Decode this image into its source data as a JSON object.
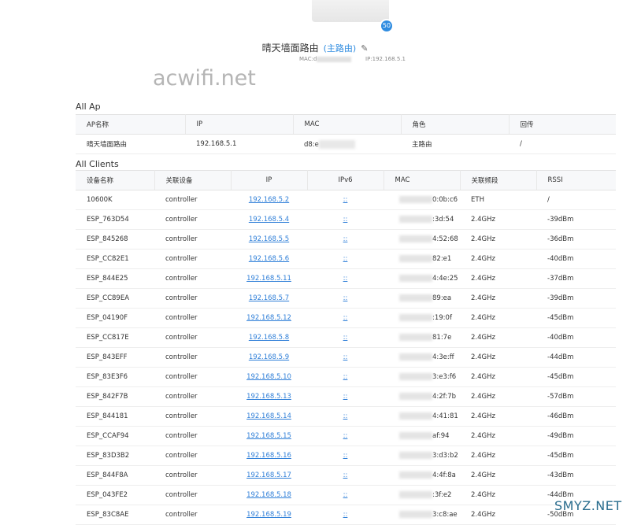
{
  "device": {
    "badge": "50"
  },
  "router": {
    "name": "晴天墙面路由",
    "role": "(主路由)",
    "mac_label": "MAC:d",
    "ip_label": "IP:192.168.5.1"
  },
  "watermark": "acwifi.net",
  "ap_section": {
    "title": "All Ap",
    "headers": [
      "AP名称",
      "IP",
      "MAC",
      "角色",
      "回传"
    ],
    "rows": [
      {
        "name": "晴天墙面路由",
        "ip": "192.168.5.1",
        "mac": "d8:e",
        "role": "主路由",
        "backhaul": "/"
      }
    ]
  },
  "clients_section": {
    "title": "All Clients",
    "headers": [
      "设备名称",
      "关联设备",
      "IP",
      "IPv6",
      "MAC",
      "关联频段",
      "RSSI"
    ],
    "rows": [
      {
        "name": "10600K",
        "device": "controller",
        "ip": "192.168.5.2",
        "ipv6": "::",
        "mac": "0:0b:c6",
        "band": "ETH",
        "rssi": "/"
      },
      {
        "name": "ESP_763D54",
        "device": "controller",
        "ip": "192.168.5.4",
        "ipv6": "::",
        "mac": ":3d:54",
        "band": "2.4GHz",
        "rssi": "-39dBm"
      },
      {
        "name": "ESP_845268",
        "device": "controller",
        "ip": "192.168.5.5",
        "ipv6": "::",
        "mac": "4:52:68",
        "band": "2.4GHz",
        "rssi": "-36dBm"
      },
      {
        "name": "ESP_CC82E1",
        "device": "controller",
        "ip": "192.168.5.6",
        "ipv6": "::",
        "mac": "82:e1",
        "band": "2.4GHz",
        "rssi": "-40dBm"
      },
      {
        "name": "ESP_844E25",
        "device": "controller",
        "ip": "192.168.5.11",
        "ipv6": "::",
        "mac": "4:4e:25",
        "band": "2.4GHz",
        "rssi": "-37dBm"
      },
      {
        "name": "ESP_CC89EA",
        "device": "controller",
        "ip": "192.168.5.7",
        "ipv6": "::",
        "mac": "89:ea",
        "band": "2.4GHz",
        "rssi": "-39dBm"
      },
      {
        "name": "ESP_04190F",
        "device": "controller",
        "ip": "192.168.5.12",
        "ipv6": "::",
        "mac": ":19:0f",
        "band": "2.4GHz",
        "rssi": "-45dBm"
      },
      {
        "name": "ESP_CC817E",
        "device": "controller",
        "ip": "192.168.5.8",
        "ipv6": "::",
        "mac": "81:7e",
        "band": "2.4GHz",
        "rssi": "-40dBm"
      },
      {
        "name": "ESP_843EFF",
        "device": "controller",
        "ip": "192.168.5.9",
        "ipv6": "::",
        "mac": "4:3e:ff",
        "band": "2.4GHz",
        "rssi": "-44dBm"
      },
      {
        "name": "ESP_83E3F6",
        "device": "controller",
        "ip": "192.168.5.10",
        "ipv6": "::",
        "mac": "3:e3:f6",
        "band": "2.4GHz",
        "rssi": "-45dBm"
      },
      {
        "name": "ESP_842F7B",
        "device": "controller",
        "ip": "192.168.5.13",
        "ipv6": "::",
        "mac": "4:2f:7b",
        "band": "2.4GHz",
        "rssi": "-57dBm"
      },
      {
        "name": "ESP_844181",
        "device": "controller",
        "ip": "192.168.5.14",
        "ipv6": "::",
        "mac": "4:41:81",
        "band": "2.4GHz",
        "rssi": "-46dBm"
      },
      {
        "name": "ESP_CCAF94",
        "device": "controller",
        "ip": "192.168.5.15",
        "ipv6": "::",
        "mac": "af:94",
        "band": "2.4GHz",
        "rssi": "-49dBm"
      },
      {
        "name": "ESP_83D3B2",
        "device": "controller",
        "ip": "192.168.5.16",
        "ipv6": "::",
        "mac": "3:d3:b2",
        "band": "2.4GHz",
        "rssi": "-45dBm"
      },
      {
        "name": "ESP_844F8A",
        "device": "controller",
        "ip": "192.168.5.17",
        "ipv6": "::",
        "mac": "4:4f:8a",
        "band": "2.4GHz",
        "rssi": "-43dBm"
      },
      {
        "name": "ESP_043FE2",
        "device": "controller",
        "ip": "192.168.5.18",
        "ipv6": "::",
        "mac": ":3f:e2",
        "band": "2.4GHz",
        "rssi": "-44dBm"
      },
      {
        "name": "ESP_83C8AE",
        "device": "controller",
        "ip": "192.168.5.19",
        "ipv6": "::",
        "mac": "3:c8:ae",
        "band": "2.4GHz",
        "rssi": "-50dBm"
      }
    ]
  },
  "site_watermark": "SMYZ.NET",
  "colors": {
    "link": "#2f7fd8",
    "badge": "#2f8ce0",
    "header_bg": "#f7f8fa"
  }
}
